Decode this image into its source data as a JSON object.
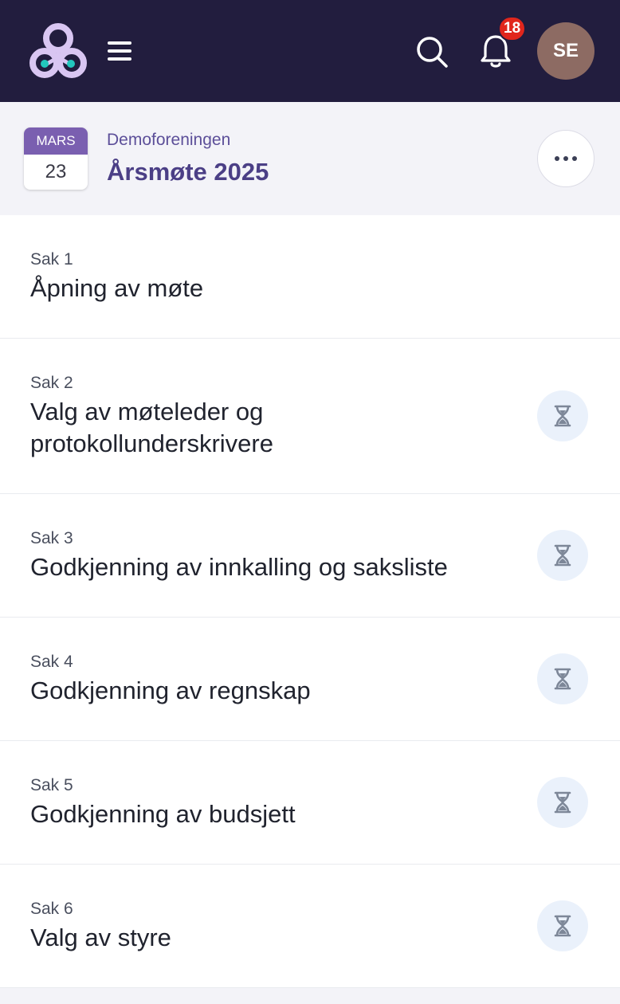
{
  "header": {
    "notification_count": "18",
    "avatar_initials": "SE"
  },
  "colors": {
    "topbar": "#221d3e",
    "accent": "#4b3f86",
    "calendar_month_bg": "#7a5fb0",
    "badge": "#e1261c",
    "avatar_bg": "#8d6b63",
    "status_bg": "#eaf1fb"
  },
  "meeting": {
    "month": "MARS",
    "day": "23",
    "organization": "Demoforeningen",
    "title": "Årsmøte 2025"
  },
  "agenda": [
    {
      "label": "Sak 1",
      "title": "Åpning av møte",
      "status_icon": null
    },
    {
      "label": "Sak 2",
      "title": "Valg av møteleder og protokollunderskrivere",
      "status_icon": "hourglass-icon"
    },
    {
      "label": "Sak 3",
      "title": "Godkjenning av innkalling og saksliste",
      "status_icon": "hourglass-icon"
    },
    {
      "label": "Sak 4",
      "title": "Godkjenning av regnskap",
      "status_icon": "hourglass-icon"
    },
    {
      "label": "Sak 5",
      "title": "Godkjenning av budsjett",
      "status_icon": "hourglass-icon"
    },
    {
      "label": "Sak 6",
      "title": "Valg av styre",
      "status_icon": "hourglass-icon"
    }
  ]
}
